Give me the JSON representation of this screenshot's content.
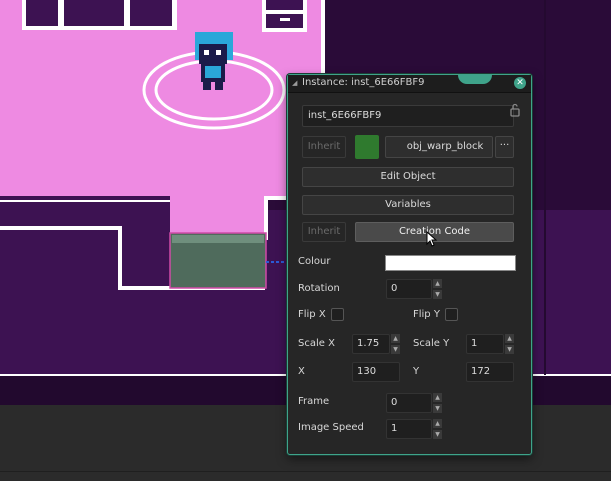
{
  "window": {
    "title": "Instance: inst_6E66FBF9"
  },
  "instance": {
    "name": "inst_6E66FBF9",
    "inherit_label": "Inherit",
    "object_name": "obj_warp_block",
    "more_label": "···",
    "edit_object_label": "Edit Object",
    "variables_label": "Variables",
    "inherit_label_2": "Inherit",
    "creation_code_label": "Creation Code",
    "object_color": "#2f7a2e"
  },
  "properties": {
    "colour_label": "Colour",
    "colour_value": "#ffffff",
    "rotation_label": "Rotation",
    "rotation_value": "0",
    "flipx_label": "Flip X",
    "flipy_label": "Flip Y",
    "flipx_checked": false,
    "flipy_checked": false,
    "scalex_label": "Scale X",
    "scalex_value": "1.75",
    "scaley_label": "Scale Y",
    "scaley_value": "1",
    "x_label": "X",
    "x_value": "130",
    "y_label": "Y",
    "y_value": "172",
    "frame_label": "Frame",
    "frame_value": "0",
    "image_speed_label": "Image Speed",
    "image_speed_value": "1"
  },
  "colors": {
    "room_floor": "#ed8ae0",
    "room_wall": "#3b1450",
    "room_dark": "#1c0826",
    "panel_accent": "#3fa38a"
  }
}
